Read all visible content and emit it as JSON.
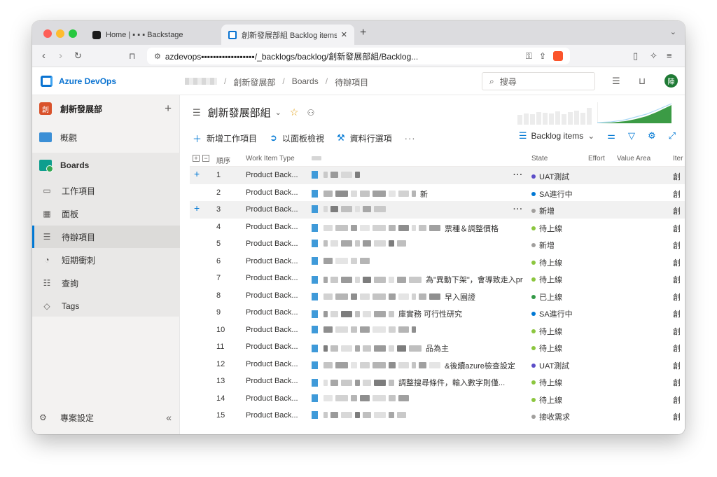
{
  "browser": {
    "tabs": [
      {
        "label": "Home | ▪ ▪ ▪ Backstage",
        "close": ""
      },
      {
        "label": "創新發展部組 Backlog items ▾",
        "close": "✕"
      }
    ],
    "new_tab": "+",
    "tab_menu": "⌄",
    "url": "azdevops▪▪▪▪▪▪▪▪▪▪▪▪▪▪▪▪▪▪/_backlogs/backlog/創新發展部組/Backlog..."
  },
  "ado": {
    "brand": "Azure DevOps",
    "breadcrumbs": [
      "創新發展部",
      "Boards",
      "待辦項目"
    ],
    "search_placeholder": "搜尋",
    "avatar_initial": "陣"
  },
  "sidebar": {
    "project_name": "創新發展部",
    "project_icon": "創",
    "overview": "概觀",
    "boards": "Boards",
    "items": [
      {
        "label": "工作項目",
        "icon": "work-items-icon"
      },
      {
        "label": "面板",
        "icon": "board-icon"
      },
      {
        "label": "待辦項目",
        "icon": "backlog-icon"
      },
      {
        "label": "短期衝刺",
        "icon": "sprint-icon"
      },
      {
        "label": "查詢",
        "icon": "query-icon"
      },
      {
        "label": "Tags",
        "icon": "tag-icon"
      }
    ],
    "settings": "專案設定"
  },
  "main": {
    "title": "創新發展部組",
    "commands": {
      "new_item": "新增工作項目",
      "view_board": "以面板檢視",
      "column_options": "資料行選項",
      "more": "···"
    },
    "view_selector": "Backlog items",
    "columns": {
      "order": "順序",
      "type": "Work Item Type",
      "title": "",
      "state": "State",
      "effort": "Effort",
      "value_area": "Value Area",
      "iteration": "Iter"
    },
    "rows": [
      {
        "order": "1",
        "type": "Product Back...",
        "title_suffix": "",
        "state": "UAT測試",
        "state_color": "#5c4ec8",
        "iteration": "創",
        "highlight": true
      },
      {
        "order": "2",
        "type": "Product Back...",
        "title_suffix": "新",
        "state": "SA進行中",
        "state_color": "#0078d4",
        "iteration": "創",
        "highlight": false
      },
      {
        "order": "3",
        "type": "Product Back...",
        "title_suffix": "",
        "state": "新增",
        "state_color": "#a19f9d",
        "iteration": "創",
        "highlight": true
      },
      {
        "order": "4",
        "type": "Product Back...",
        "title_suffix": "票種＆調整價格",
        "state": "待上線",
        "state_color": "#8cc63f",
        "iteration": "創",
        "highlight": false
      },
      {
        "order": "5",
        "type": "Product Back...",
        "title_suffix": "",
        "state": "新增",
        "state_color": "#a19f9d",
        "iteration": "創",
        "highlight": false
      },
      {
        "order": "6",
        "type": "Product Back...",
        "title_suffix": "",
        "state": "待上線",
        "state_color": "#8cc63f",
        "iteration": "創",
        "highlight": false
      },
      {
        "order": "7",
        "type": "Product Back...",
        "title_suffix": "為\"異動下架\"，會導致走入pr...",
        "state": "待上線",
        "state_color": "#8cc63f",
        "iteration": "創",
        "highlight": false
      },
      {
        "order": "8",
        "type": "Product Back...",
        "title_suffix": "早入園證",
        "state": "已上線",
        "state_color": "#339947",
        "iteration": "創",
        "highlight": false
      },
      {
        "order": "9",
        "type": "Product Back...",
        "title_suffix": "庫實務 可行性研究",
        "state": "SA進行中",
        "state_color": "#0078d4",
        "iteration": "創",
        "highlight": false
      },
      {
        "order": "10",
        "type": "Product Back...",
        "title_suffix": "",
        "state": "待上線",
        "state_color": "#8cc63f",
        "iteration": "創",
        "highlight": false
      },
      {
        "order": "11",
        "type": "Product Back...",
        "title_suffix": "品為主",
        "state": "待上線",
        "state_color": "#8cc63f",
        "iteration": "創",
        "highlight": false
      },
      {
        "order": "12",
        "type": "Product Back...",
        "title_suffix": "&後續azure檢查設定",
        "state": "UAT測試",
        "state_color": "#5c4ec8",
        "iteration": "創",
        "highlight": false
      },
      {
        "order": "13",
        "type": "Product Back...",
        "title_suffix": "調整搜尋條件，輸入數字則僅...",
        "state": "待上線",
        "state_color": "#8cc63f",
        "iteration": "創",
        "highlight": false
      },
      {
        "order": "14",
        "type": "Product Back...",
        "title_suffix": "",
        "state": "待上線",
        "state_color": "#8cc63f",
        "iteration": "創",
        "highlight": false
      },
      {
        "order": "15",
        "type": "Product Back...",
        "title_suffix": "",
        "state": "接收需求",
        "state_color": "#a19f9d",
        "iteration": "創",
        "highlight": false
      }
    ]
  }
}
